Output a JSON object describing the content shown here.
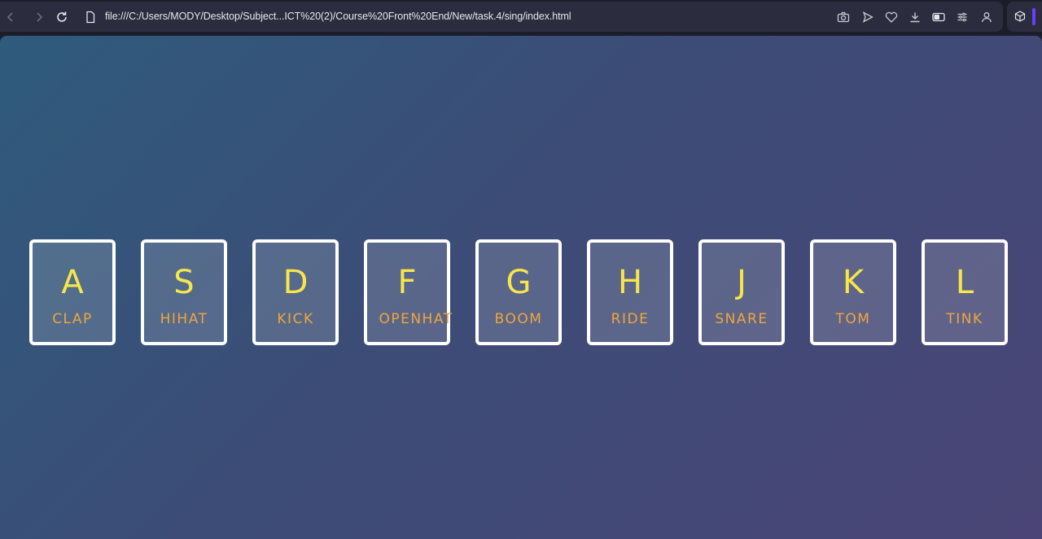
{
  "browser": {
    "url": "file:///C:/Users/MODY/Desktop/Subject...ICT%20(2)/Course%20Front%20End/New/task.4/sing/index.html",
    "icons": [
      "back-icon",
      "forward-icon",
      "reload-icon",
      "page-info-icon",
      "camera-icon",
      "send-icon",
      "heart-icon",
      "download-icon",
      "toggle-icon",
      "settings-icon",
      "profile-icon",
      "extension-icon"
    ],
    "accent": "#6c3cff"
  },
  "drum_keys": [
    {
      "letter": "A",
      "sound": "CLAP"
    },
    {
      "letter": "S",
      "sound": "HIHAT"
    },
    {
      "letter": "D",
      "sound": "KICK"
    },
    {
      "letter": "F",
      "sound": "OPENHAT"
    },
    {
      "letter": "G",
      "sound": "BOOM"
    },
    {
      "letter": "H",
      "sound": "RIDE"
    },
    {
      "letter": "J",
      "sound": "SNARE"
    },
    {
      "letter": "K",
      "sound": "TOM"
    },
    {
      "letter": "L",
      "sound": "TINK"
    }
  ],
  "colors": {
    "letter": "#f7e64a",
    "sound": "#f0a63a",
    "border": "#ffffff",
    "gradient_start": "#2f5b7c",
    "gradient_end": "#4a4576"
  }
}
